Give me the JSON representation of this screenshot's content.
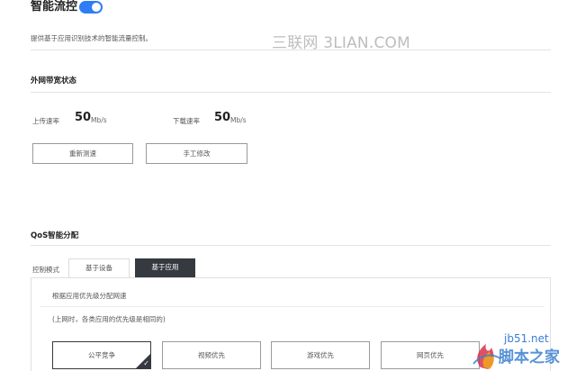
{
  "header": {
    "title": "智能流控",
    "toggle_on": true,
    "description": "提供基于应用识别技术的智能流量控制。"
  },
  "watermark_top": "三联网 3LIAN.COM",
  "bandwidth": {
    "section_title": "外网带宽状态",
    "upload_label": "上传速率",
    "upload_value": "50",
    "upload_unit": "Mb/s",
    "download_label": "下载速率",
    "download_value": "50",
    "download_unit": "Mb/s",
    "retest_button": "重新测速",
    "manual_button": "手工修改"
  },
  "qos": {
    "section_title": "QoS智能分配",
    "mode_label": "控制模式",
    "tabs": [
      "基于设备",
      "基于应用"
    ],
    "active_tab": 1,
    "hint": "根据应用优先级分配网速",
    "note": "(上网时，各类应用的优先级是相同的)",
    "options": [
      "公平竞争",
      "视频优先",
      "游戏优先",
      "网页优先"
    ],
    "selected_option": 0
  },
  "watermark_logo": {
    "text1": "jb51.net",
    "text2": "脚本之家"
  },
  "colors": {
    "accent": "#2f7df6",
    "dark": "#353a40"
  }
}
